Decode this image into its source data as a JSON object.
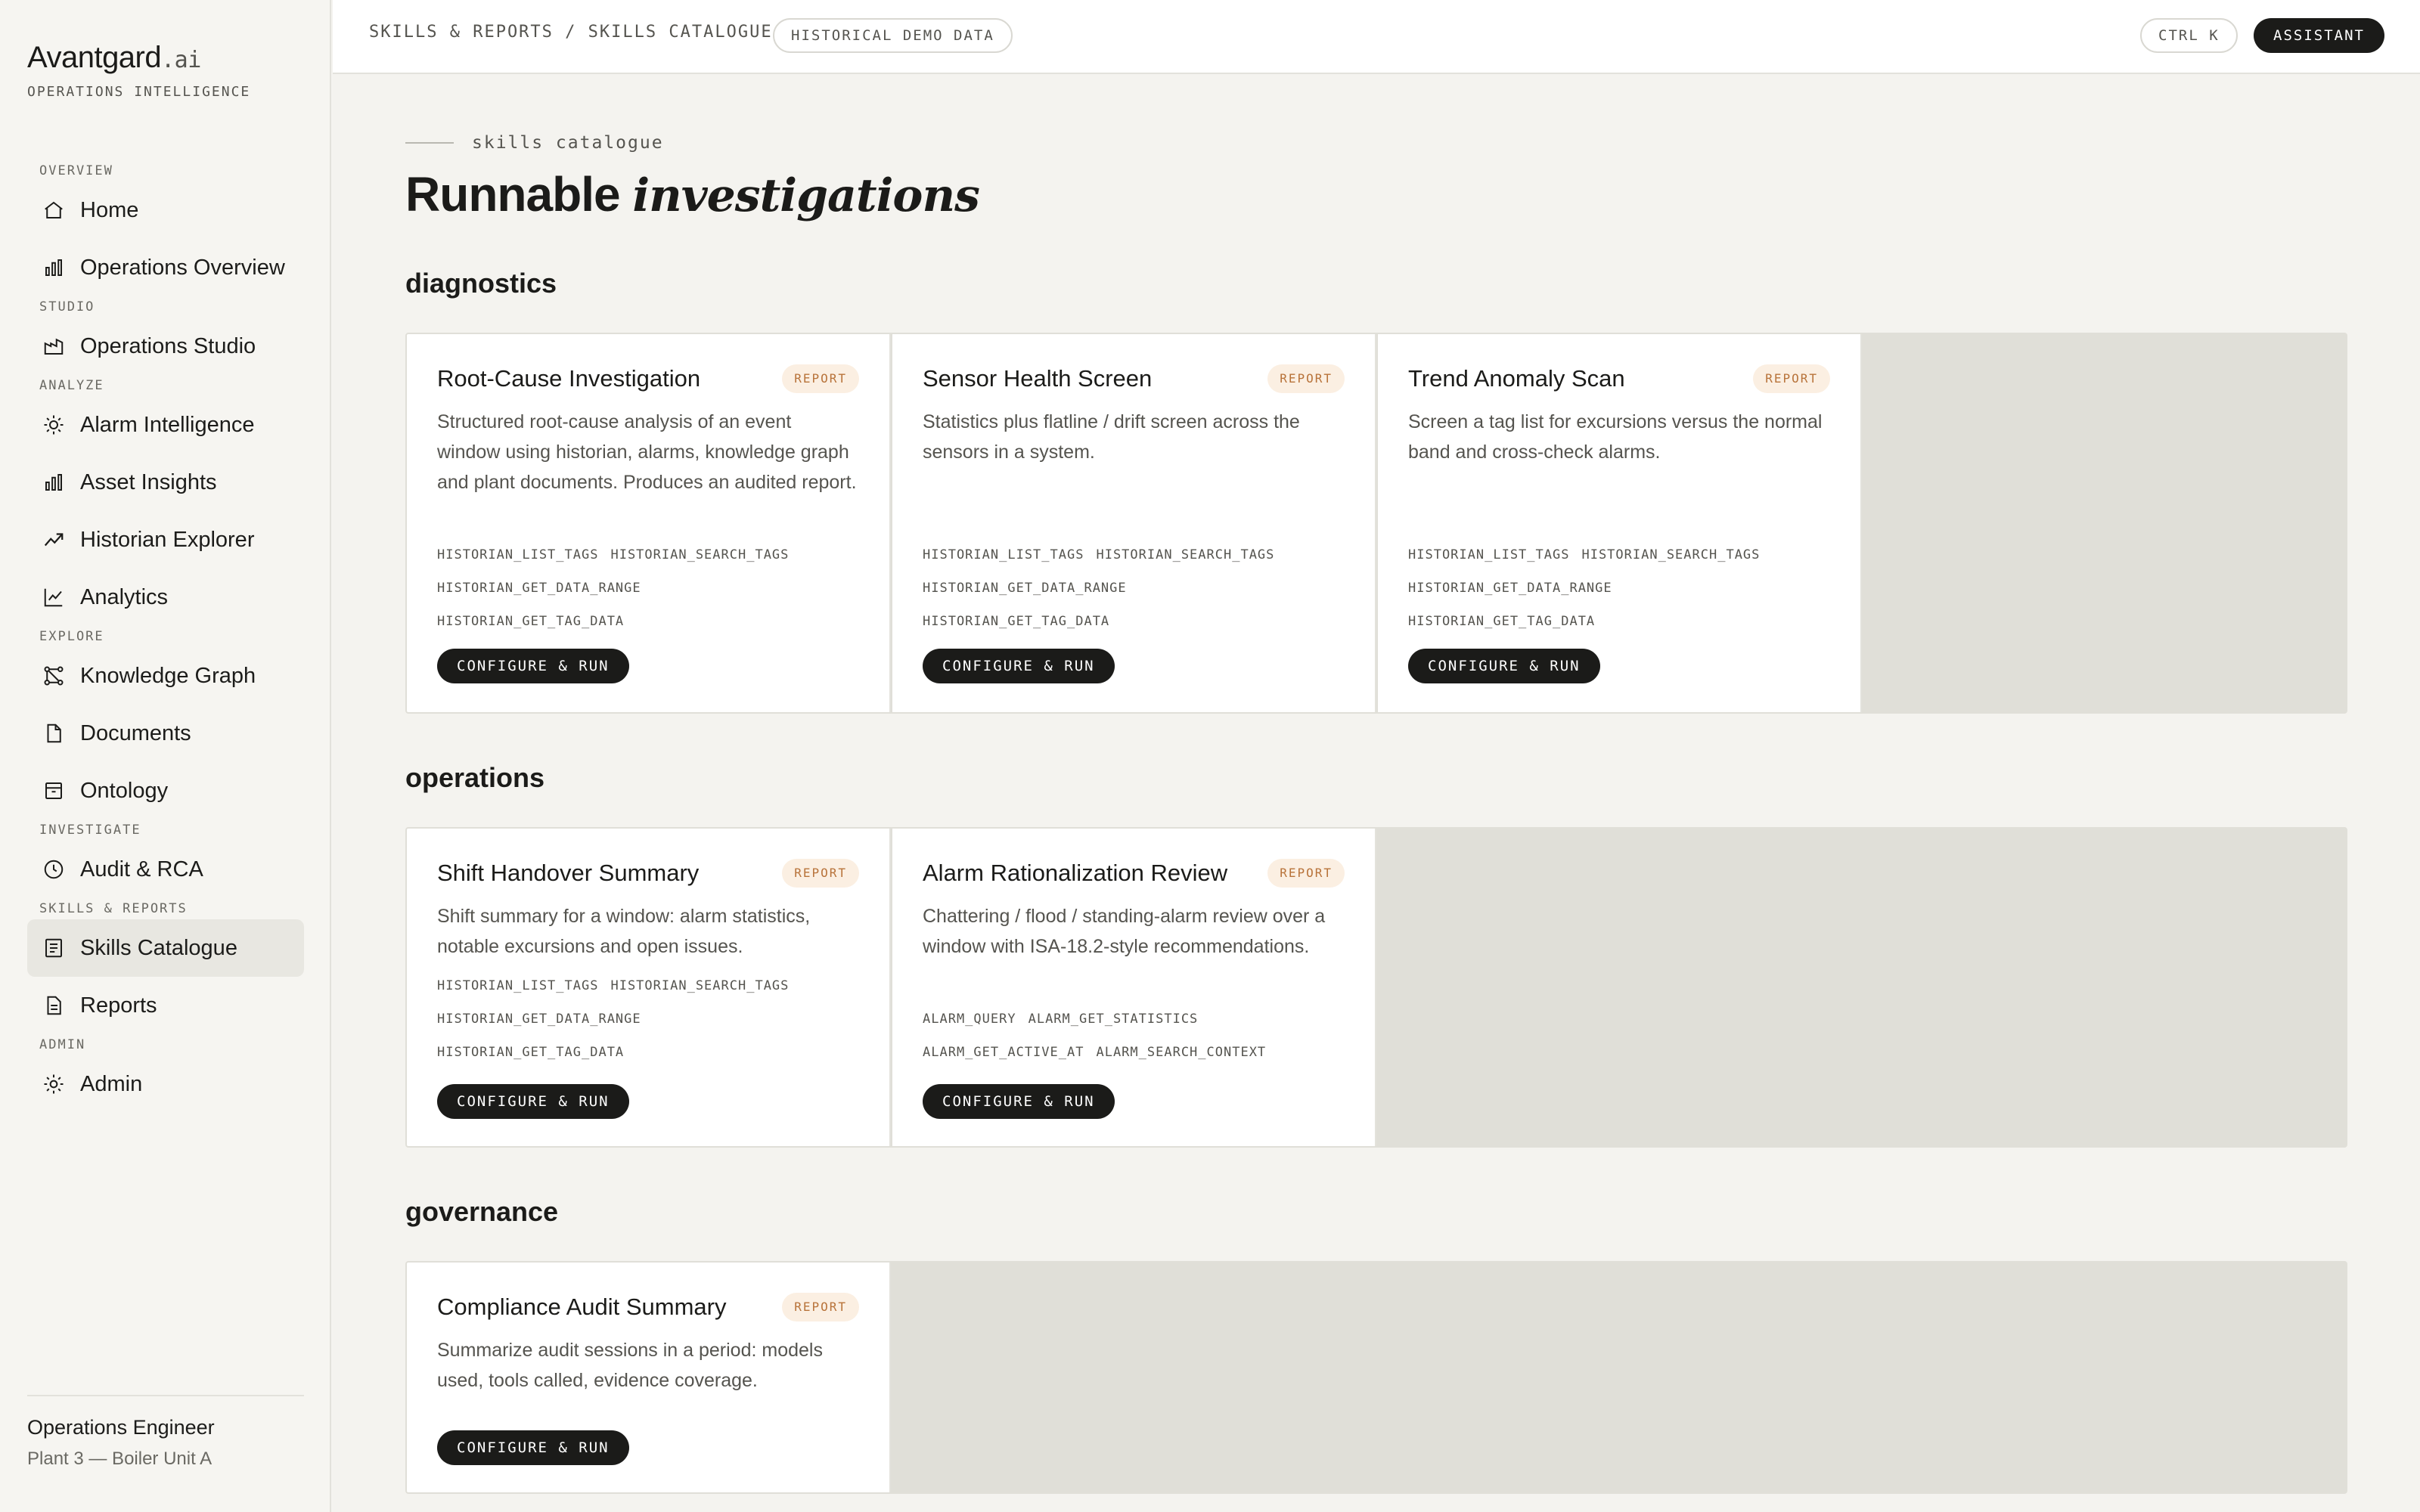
{
  "brand": {
    "name": "Avantgard",
    "suffix": ".ai",
    "subtitle": "OPERATIONS INTELLIGENCE"
  },
  "nav": {
    "overview_label": "OVERVIEW",
    "home": "Home",
    "operations_overview": "Operations Overview",
    "studio_label": "STUDIO",
    "operations_studio": "Operations Studio",
    "analyze_label": "ANALYZE",
    "alarm_intelligence": "Alarm Intelligence",
    "asset_insights": "Asset Insights",
    "historian_explorer": "Historian Explorer",
    "analytics": "Analytics",
    "explore_label": "EXPLORE",
    "knowledge_graph": "Knowledge Graph",
    "documents": "Documents",
    "ontology": "Ontology",
    "investigate_label": "INVESTIGATE",
    "audit_rca": "Audit & RCA",
    "skills_reports_label": "SKILLS & REPORTS",
    "skills_catalogue": "Skills Catalogue",
    "reports": "Reports",
    "admin_label": "ADMIN",
    "admin": "Admin",
    "active": "skills_catalogue"
  },
  "user": {
    "role": "Operations Engineer",
    "site": "Plant 3 — Boiler Unit A"
  },
  "topbar": {
    "breadcrumb": "SKILLS & REPORTS / SKILLS CATALOGUE",
    "demo_badge": "HISTORICAL DEMO DATA",
    "shortcut": "CTRL K",
    "assistant": "ASSISTANT"
  },
  "page": {
    "eyebrow": "skills catalogue",
    "title_plain": "Runnable",
    "title_italic": "investigations"
  },
  "sections": {
    "diagnostics": {
      "title": "diagnostics",
      "cards": [
        {
          "title": "Root-Cause Investigation",
          "badge": "REPORT",
          "description": "Structured root-cause analysis of an event window using historian, alarms, knowledge graph and plant documents. Produces an audited report.",
          "tools": [
            [
              "HISTORIAN_LIST_TAGS",
              "HISTORIAN_SEARCH_TAGS"
            ],
            [
              "HISTORIAN_GET_DATA_RANGE"
            ],
            [
              "HISTORIAN_GET_TAG_DATA"
            ]
          ],
          "action": "CONFIGURE & RUN"
        },
        {
          "title": "Sensor Health Screen",
          "badge": "REPORT",
          "description": "Statistics plus flatline / drift screen across the sensors in a system.",
          "tools": [
            [
              "HISTORIAN_LIST_TAGS",
              "HISTORIAN_SEARCH_TAGS"
            ],
            [
              "HISTORIAN_GET_DATA_RANGE"
            ],
            [
              "HISTORIAN_GET_TAG_DATA"
            ]
          ],
          "action": "CONFIGURE & RUN"
        },
        {
          "title": "Trend Anomaly Scan",
          "badge": "REPORT",
          "description": "Screen a tag list for excursions versus the normal band and cross-check alarms.",
          "tools": [
            [
              "HISTORIAN_LIST_TAGS",
              "HISTORIAN_SEARCH_TAGS"
            ],
            [
              "HISTORIAN_GET_DATA_RANGE"
            ],
            [
              "HISTORIAN_GET_TAG_DATA"
            ]
          ],
          "action": "CONFIGURE & RUN"
        }
      ]
    },
    "operations": {
      "title": "operations",
      "cards": [
        {
          "title": "Shift Handover Summary",
          "badge": "REPORT",
          "description": "Shift summary for a window: alarm statistics, notable excursions and open issues.",
          "tools": [
            [
              "HISTORIAN_LIST_TAGS",
              "HISTORIAN_SEARCH_TAGS"
            ],
            [
              "HISTORIAN_GET_DATA_RANGE"
            ],
            [
              "HISTORIAN_GET_TAG_DATA"
            ]
          ],
          "action": "CONFIGURE & RUN"
        },
        {
          "title": "Alarm Rationalization Review",
          "badge": "REPORT",
          "description": "Chattering / flood / standing-alarm review over a window with ISA-18.2-style recommendations.",
          "tools": [
            [
              "ALARM_QUERY",
              "ALARM_GET_STATISTICS"
            ],
            [
              "ALARM_GET_ACTIVE_AT",
              "ALARM_SEARCH_CONTEXT"
            ]
          ],
          "action": "CONFIGURE & RUN"
        }
      ]
    },
    "governance": {
      "title": "governance",
      "cards": [
        {
          "title": "Compliance Audit Summary",
          "badge": "REPORT",
          "description": "Summarize audit sessions in a period: models used, tools called, evidence coverage.",
          "tools": [],
          "action": "CONFIGURE & RUN"
        }
      ]
    }
  }
}
